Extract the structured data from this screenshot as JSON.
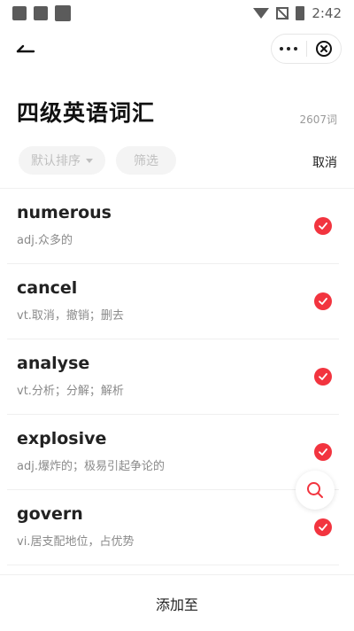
{
  "status_bar": {
    "time": "2:42",
    "left_icons": [
      "notification-icon",
      "image-icon",
      "app-icon"
    ],
    "right_icons": [
      "wifi-icon",
      "no-sim-icon",
      "battery-charging-icon"
    ]
  },
  "nav": {
    "back_icon": "back-arrow-icon",
    "more_icon": "more-dots-icon",
    "close_icon": "close-circle-icon"
  },
  "header": {
    "title": "四级英语词汇",
    "count": "2607词"
  },
  "filters": {
    "sort_label": "默认排序",
    "filter_label": "筛选",
    "cancel_label": "取消"
  },
  "words": [
    {
      "word": "numerous",
      "definition": "adj.众多的",
      "selected": true
    },
    {
      "word": "cancel",
      "definition": "vt.取消，撤销；删去",
      "selected": true
    },
    {
      "word": "analyse",
      "definition": "vt.分析；分解；解析",
      "selected": true
    },
    {
      "word": "explosive",
      "definition": "adj.爆炸的；极易引起争论的",
      "selected": true
    },
    {
      "word": "govern",
      "definition": "vi.居支配地位，占优势",
      "selected": true
    }
  ],
  "fab": {
    "icon": "search-icon"
  },
  "bottom": {
    "add_label": "添加至"
  },
  "colors": {
    "accent": "#f2343f",
    "chip_bg": "#f4f4f4",
    "chip_text": "#bfbfbf"
  }
}
